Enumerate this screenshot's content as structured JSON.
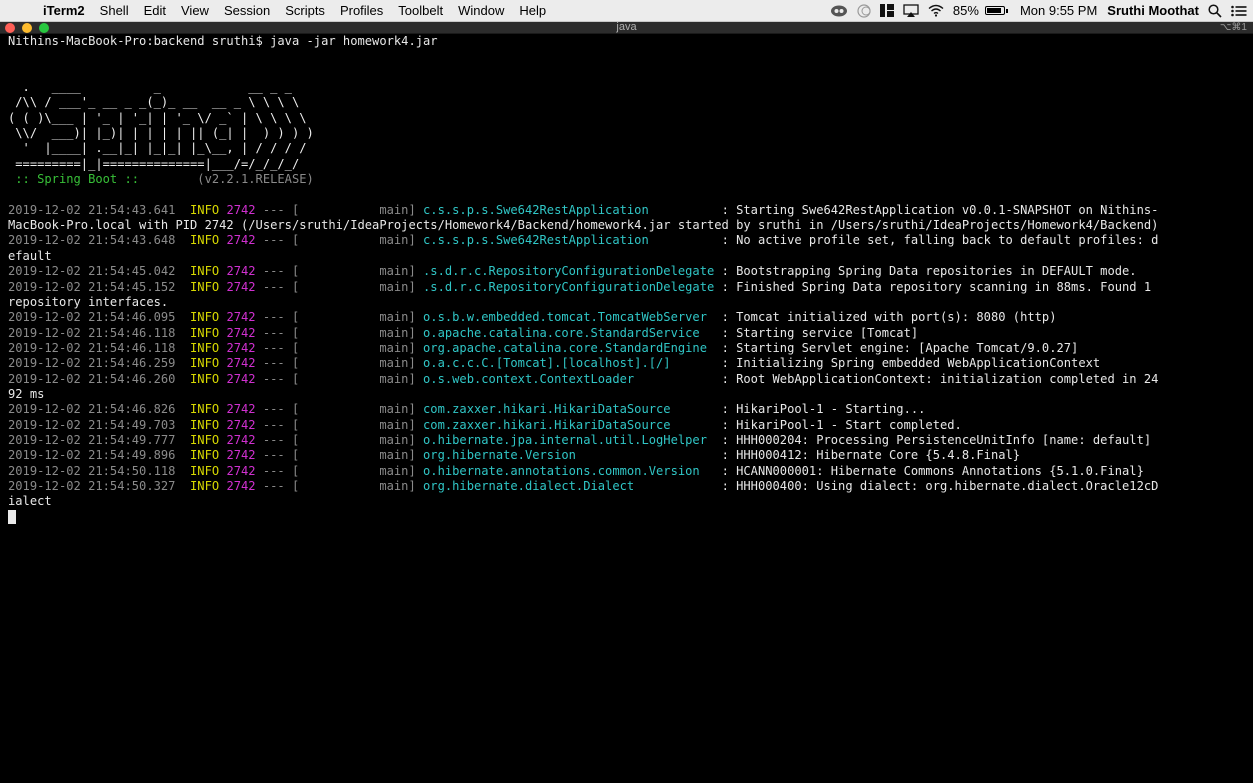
{
  "menubar": {
    "app_name": "iTerm2",
    "items": [
      "Shell",
      "Edit",
      "View",
      "Session",
      "Scripts",
      "Profiles",
      "Toolbelt",
      "Window",
      "Help"
    ],
    "battery_percent": "85%",
    "clock": "Mon 9:55 PM",
    "user": "Sruthi Moothat"
  },
  "window": {
    "title": "java",
    "shortcut": "⌥⌘1"
  },
  "terminal": {
    "prompt": "Nithins-MacBook-Pro:backend sruthi$ java -jar homework4.jar",
    "banner": [
      "",
      "  .   ____          _            __ _ _",
      " /\\\\ / ___'_ __ _ _(_)_ __  __ _ \\ \\ \\ \\",
      "( ( )\\___ | '_ | '_| | '_ \\/ _` | \\ \\ \\ \\",
      " \\\\/  ___)| |_)| | | | | || (_| |  ) ) ) )",
      "  '  |____| .__|_| |_|_| |_\\__, | / / / /",
      " =========|_|==============|___/=/_/_/_/"
    ],
    "spring_label": " :: Spring Boot :: ",
    "spring_version": "       (v2.2.1.RELEASE)",
    "log_lines": [
      {
        "ts": "2019-12-02 21:54:43.641",
        "level": "INFO",
        "pid": "2742",
        "sep": " --- [           ",
        "thread": "main]",
        "logger": "c.s.s.p.s.Swe642RestApplication",
        "pad": "          ",
        "message": ": Starting Swe642RestApplication v0.0.1-SNAPSHOT on Nithins-",
        "cont": "MacBook-Pro.local with PID 2742 (/Users/sruthi/IdeaProjects/Homework4/Backend/homework4.jar started by sruthi in /Users/sruthi/IdeaProjects/Homework4/Backend)"
      },
      {
        "ts": "2019-12-02 21:54:43.648",
        "level": "INFO",
        "pid": "2742",
        "sep": " --- [           ",
        "thread": "main]",
        "logger": "c.s.s.p.s.Swe642RestApplication",
        "pad": "          ",
        "message": ": No active profile set, falling back to default profiles: d",
        "cont": "efault"
      },
      {
        "ts": "2019-12-02 21:54:45.042",
        "level": "INFO",
        "pid": "2742",
        "sep": " --- [           ",
        "thread": "main]",
        "logger": ".s.d.r.c.RepositoryConfigurationDelegate",
        "pad": " ",
        "message": ": Bootstrapping Spring Data repositories in DEFAULT mode.",
        "cont": ""
      },
      {
        "ts": "2019-12-02 21:54:45.152",
        "level": "INFO",
        "pid": "2742",
        "sep": " --- [           ",
        "thread": "main]",
        "logger": ".s.d.r.c.RepositoryConfigurationDelegate",
        "pad": " ",
        "message": ": Finished Spring Data repository scanning in 88ms. Found 1",
        "cont": "repository interfaces."
      },
      {
        "ts": "2019-12-02 21:54:46.095",
        "level": "INFO",
        "pid": "2742",
        "sep": " --- [           ",
        "thread": "main]",
        "logger": "o.s.b.w.embedded.tomcat.TomcatWebServer",
        "pad": "  ",
        "message": ": Tomcat initialized with port(s): 8080 (http)",
        "cont": ""
      },
      {
        "ts": "2019-12-02 21:54:46.118",
        "level": "INFO",
        "pid": "2742",
        "sep": " --- [           ",
        "thread": "main]",
        "logger": "o.apache.catalina.core.StandardService",
        "pad": "   ",
        "message": ": Starting service [Tomcat]",
        "cont": ""
      },
      {
        "ts": "2019-12-02 21:54:46.118",
        "level": "INFO",
        "pid": "2742",
        "sep": " --- [           ",
        "thread": "main]",
        "logger": "org.apache.catalina.core.StandardEngine",
        "pad": "  ",
        "message": ": Starting Servlet engine: [Apache Tomcat/9.0.27]",
        "cont": ""
      },
      {
        "ts": "2019-12-02 21:54:46.259",
        "level": "INFO",
        "pid": "2742",
        "sep": " --- [           ",
        "thread": "main]",
        "logger": "o.a.c.c.C.[Tomcat].[localhost].[/]",
        "pad": "       ",
        "message": ": Initializing Spring embedded WebApplicationContext",
        "cont": ""
      },
      {
        "ts": "2019-12-02 21:54:46.260",
        "level": "INFO",
        "pid": "2742",
        "sep": " --- [           ",
        "thread": "main]",
        "logger": "o.s.web.context.ContextLoader",
        "pad": "            ",
        "message": ": Root WebApplicationContext: initialization completed in 24",
        "cont": "92 ms"
      },
      {
        "ts": "2019-12-02 21:54:46.826",
        "level": "INFO",
        "pid": "2742",
        "sep": " --- [           ",
        "thread": "main]",
        "logger": "com.zaxxer.hikari.HikariDataSource",
        "pad": "       ",
        "message": ": HikariPool-1 - Starting...",
        "cont": ""
      },
      {
        "ts": "2019-12-02 21:54:49.703",
        "level": "INFO",
        "pid": "2742",
        "sep": " --- [           ",
        "thread": "main]",
        "logger": "com.zaxxer.hikari.HikariDataSource",
        "pad": "       ",
        "message": ": HikariPool-1 - Start completed.",
        "cont": ""
      },
      {
        "ts": "2019-12-02 21:54:49.777",
        "level": "INFO",
        "pid": "2742",
        "sep": " --- [           ",
        "thread": "main]",
        "logger": "o.hibernate.jpa.internal.util.LogHelper",
        "pad": "  ",
        "message": ": HHH000204: Processing PersistenceUnitInfo [name: default]",
        "cont": ""
      },
      {
        "ts": "2019-12-02 21:54:49.896",
        "level": "INFO",
        "pid": "2742",
        "sep": " --- [           ",
        "thread": "main]",
        "logger": "org.hibernate.Version",
        "pad": "                    ",
        "message": ": HHH000412: Hibernate Core {5.4.8.Final}",
        "cont": ""
      },
      {
        "ts": "2019-12-02 21:54:50.118",
        "level": "INFO",
        "pid": "2742",
        "sep": " --- [           ",
        "thread": "main]",
        "logger": "o.hibernate.annotations.common.Version",
        "pad": "   ",
        "message": ": HCANN000001: Hibernate Commons Annotations {5.1.0.Final}",
        "cont": ""
      },
      {
        "ts": "2019-12-02 21:54:50.327",
        "level": "INFO",
        "pid": "2742",
        "sep": " --- [           ",
        "thread": "main]",
        "logger": "org.hibernate.dialect.Dialect",
        "pad": "            ",
        "message": ": HHH000400: Using dialect: org.hibernate.dialect.Oracle12cD",
        "cont": "ialect"
      }
    ]
  },
  "colors": {
    "info": "#d7d800",
    "pid": "#d030d0",
    "logger": "#30c6c6",
    "spring": "#38c038",
    "dim": "#8a8a8a"
  }
}
